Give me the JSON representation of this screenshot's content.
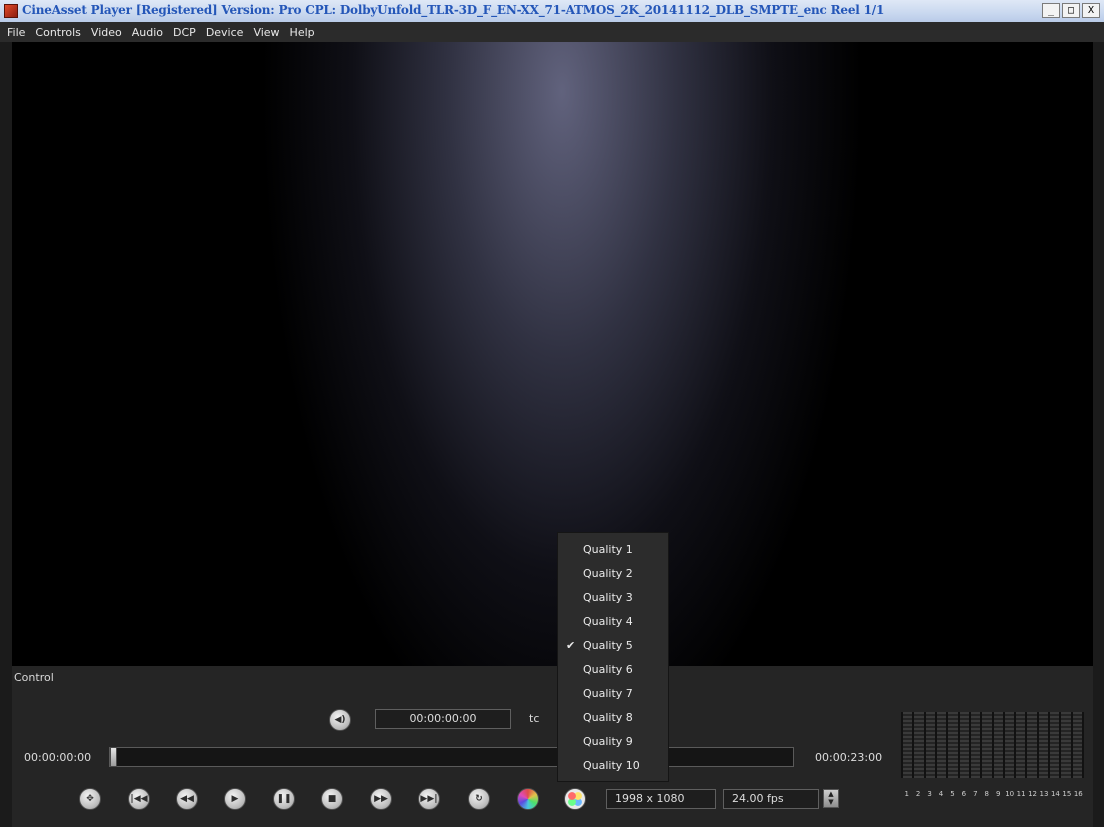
{
  "window": {
    "title": "CineAsset Player [Registered] Version: Pro  CPL: DolbyUnfold_TLR-3D_F_EN-XX_71-ATMOS_2K_20141112_DLB_SMPTE_enc  Reel 1/1",
    "minimize_label": "_",
    "maximize_label": "□",
    "close_label": "X"
  },
  "menu": {
    "items": [
      "File",
      "Controls",
      "Video",
      "Audio",
      "DCP",
      "Device",
      "View",
      "Help"
    ]
  },
  "control": {
    "title": "Control",
    "timecode": "00:00:00:00",
    "tc_label": "tc",
    "start_time": "00:00:00:00",
    "end_time": "00:00:23:00",
    "playback_position": 0,
    "resolution": "1998 x 1080",
    "fps": "24.00 fps"
  },
  "meters": {
    "channel_labels": [
      "1",
      "2",
      "3",
      "4",
      "5",
      "6",
      "7",
      "8",
      "9",
      "10",
      "11",
      "12",
      "13",
      "14",
      "15",
      "16"
    ]
  },
  "icons": {
    "audio": "speaker-icon",
    "transport": [
      "move-icon",
      "go-to-start-icon",
      "rewind-icon",
      "play-icon",
      "pause-icon",
      "stop-icon",
      "fast-forward-icon",
      "go-to-end-icon",
      "loop-icon",
      "color-wheel-icon",
      "quality-icon"
    ]
  },
  "quality_menu": {
    "items": [
      "Quality 1",
      "Quality 2",
      "Quality 3",
      "Quality 4",
      "Quality 5",
      "Quality 6",
      "Quality 7",
      "Quality 8",
      "Quality 9",
      "Quality 10"
    ],
    "selected": "Quality 5",
    "check_mark": "✔"
  },
  "colors": {
    "title_text": "#2456b8",
    "background": "#252525",
    "viewport": "#000000"
  }
}
